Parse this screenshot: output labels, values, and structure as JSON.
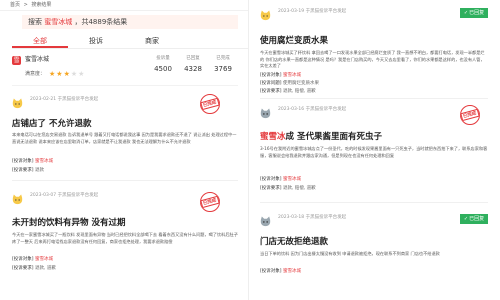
{
  "breadcrumb": [
    "首页",
    ">",
    "搜索结果"
  ],
  "search": {
    "prefix": "搜索",
    "keyword": "蜜雪冰城",
    "suffix": "，共4889条结果"
  },
  "tabs": [
    "全部",
    "投诉",
    "商家"
  ],
  "company": {
    "logo_text": "雪",
    "name": "蜜雪冰城",
    "rating_label": "满意度：",
    "rating": 3,
    "rating_max": 5,
    "stats": [
      {
        "label": "投诉量",
        "value": "4500"
      },
      {
        "label": "已回复",
        "value": "4328"
      },
      {
        "label": "已完成",
        "value": "3769"
      }
    ]
  },
  "left_cards": [
    {
      "meta": "2023-02-21 于黑猫投诉平台发起",
      "title": "店铺店了 不允许退款",
      "body": "本来电话可以在您店交易退款 告诉我退单号 跟着又打电话都说我这事 因为是我要求退款还不退了 说让派出 处理过程中一直说无法退款 说本来应该在店里取消订单，店家就是不让我退款 我也无法理解为什么不允许退款",
      "lines": [
        {
          "label": "[投诉对象]",
          "value": "蜜雪冰城",
          "hl": true
        },
        {
          "label": "[投诉要求]",
          "value": "退款",
          "hl": false
        }
      ],
      "stamp": "已完成"
    },
    {
      "meta": "2023-03-07 于黑猫投诉平台发起",
      "title": "未开封的饮料有异物 没有过期",
      "body": "今天在一家蜜雪冰城买了一瓶饮料 发现里面有异物 当时已经把饮料全部喝下去 看着东西又没有什么问题，喝了饮料后肚子疼了一整天 后来再打电话找店家退款没有任何回复，商家也拒绝处理，我要求退款赔偿",
      "lines": [
        {
          "label": "[投诉对象]",
          "value": "蜜雪冰城",
          "hl": true
        },
        {
          "label": "[投诉要求]",
          "value": "退款, 道歉",
          "hl": false
        }
      ],
      "stamp": "已完成"
    }
  ],
  "right_cards": [
    {
      "meta": "2023-03-19 于黑猫投诉平台发起",
      "badge": "已回复",
      "title": "使用腐烂变质水果",
      "body": "今天在蜜雪冰城买了杯饮料 拿回去喝了一口发现水果全部已经腐烂变质了 我一直想不明白，都要打电话，发现一半都是烂的 你们店的水果一直都是这种情况 是吗？我是在门店购买的，今天又去店里看了，你们的水果都是这样的，也没有人管，实在太差了",
      "lines": [
        {
          "label": "[投诉对象]",
          "value": "蜜雪冰城",
          "hl": true
        },
        {
          "label": "[投诉问题]",
          "value": "使用腐烂变质水果",
          "hl": false
        },
        {
          "label": "[投诉要求]",
          "value": "退款, 赔偿, 道歉",
          "hl": false
        }
      ]
    },
    {
      "meta": "2023-03-16 于黑猫投诉平台发起",
      "title_hl": "蜜雪冰",
      "title_rest": "成 圣代果酱里面有死虫子",
      "body": "3-16号在我附近的蜜雪冰城店点了一份圣代，吃的时候发现果酱里面有一只死虫子，当时就把东西拍下来了，联系店家和客服，客服说会给我退款并跟店家沟通，但是到现在也没有任何处理和回复",
      "lines": [
        {
          "label": "[投诉对象]",
          "value": "蜜雪冰城",
          "hl": true
        },
        {
          "label": "[投诉要求]",
          "value": "退款, 赔偿, 道歉",
          "hl": false
        }
      ],
      "stamp": "已完成"
    },
    {
      "meta": "2023-03-18 于黑猫投诉平台发起",
      "badge": "已回复",
      "title": "门店无故拒绝退款",
      "body": "当日下单的饮料 因为门店出餐太慢没有收到 申请退款被拒绝，现在联系不到商家 门店也不给退款",
      "lines": [
        {
          "label": "[投诉对象]",
          "value": "蜜雪冰城",
          "hl": true
        }
      ]
    }
  ],
  "colors": {
    "accent": "#e4393c",
    "badge": "#2fb05e",
    "star": "#f5a623"
  }
}
